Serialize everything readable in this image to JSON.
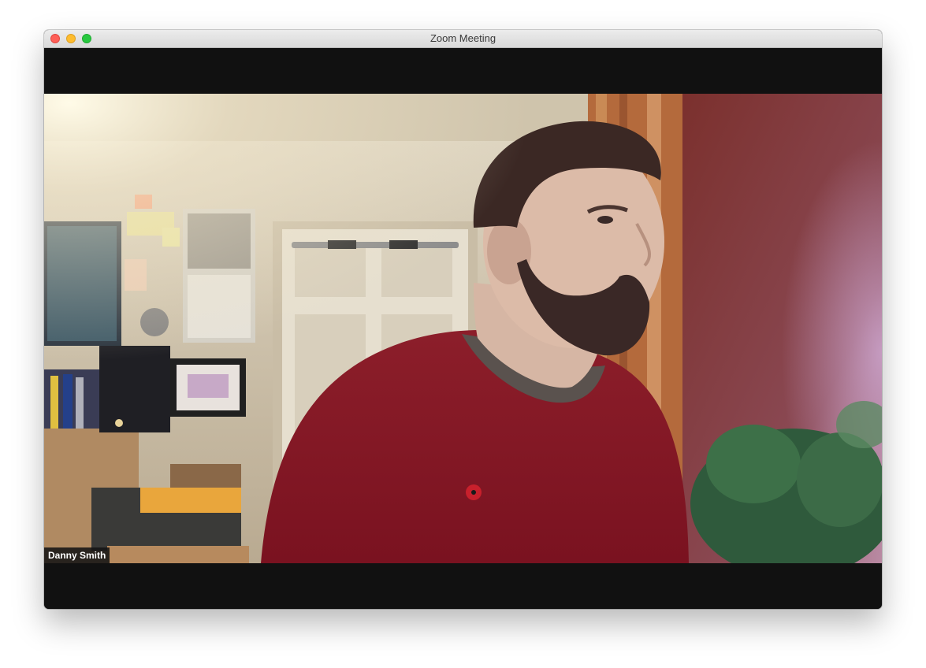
{
  "window": {
    "title": "Zoom Meeting"
  },
  "participant": {
    "name": "Danny Smith"
  },
  "icons": [
    "close-button",
    "minimize-button",
    "zoom-button"
  ],
  "colors": {
    "letterbox": "#111111",
    "titlebar": "#e5e5e5",
    "name_tag_bg": "#141414"
  }
}
